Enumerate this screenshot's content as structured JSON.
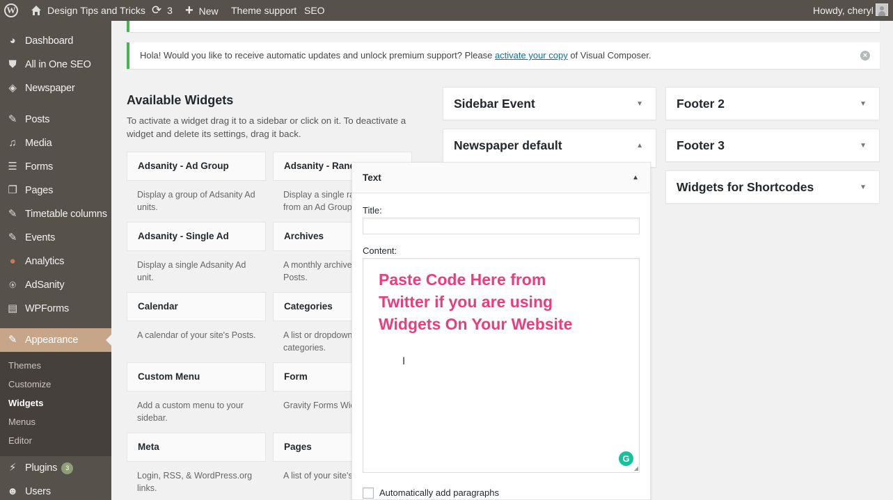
{
  "admin_bar": {
    "site_name": "Design Tips and Tricks",
    "updates_count": "3",
    "new_label": "New",
    "theme_support_label": "Theme support",
    "seo_label": "SEO",
    "howdy": "Howdy, cheryl"
  },
  "sidebar": {
    "items": [
      {
        "label": "Dashboard",
        "icon": "dashboard-icon"
      },
      {
        "label": "All in One SEO",
        "icon": "shield-icon"
      },
      {
        "label": "Newspaper",
        "icon": "newspaper-icon"
      },
      {
        "label": "Posts",
        "icon": "pin-icon"
      },
      {
        "label": "Media",
        "icon": "media-icon"
      },
      {
        "label": "Forms",
        "icon": "forms-icon"
      },
      {
        "label": "Pages",
        "icon": "pages-icon"
      },
      {
        "label": "Timetable columns",
        "icon": "pin-icon"
      },
      {
        "label": "Events",
        "icon": "pin-icon"
      },
      {
        "label": "Analytics",
        "icon": "analytics-icon"
      },
      {
        "label": "AdSanity",
        "icon": "adsanity-icon"
      },
      {
        "label": "WPForms",
        "icon": "wpforms-icon"
      },
      {
        "label": "Appearance",
        "icon": "brush-icon"
      },
      {
        "label": "Plugins",
        "icon": "plugin-icon",
        "badge": "3"
      },
      {
        "label": "Users",
        "icon": "users-icon"
      }
    ],
    "submenu": [
      "Themes",
      "Customize",
      "Widgets",
      "Menus",
      "Editor"
    ],
    "current_submenu": "Widgets"
  },
  "notice": {
    "text_before": "Hola! Would you like to receive automatic updates and unlock premium support? Please ",
    "link": "activate your copy",
    "text_after": " of Visual Composer."
  },
  "available_widgets": {
    "title": "Available Widgets",
    "description": "To activate a widget drag it to a sidebar or click on it. To deactivate a widget and delete its settings, drag it back.",
    "widgets": [
      {
        "title": "Adsanity - Ad Group",
        "desc1": "Display a group of Adsanity Ad",
        "desc2": "units."
      },
      {
        "title": "Adsanity - Random",
        "desc1": "Display a single random",
        "desc2": "from an Ad Group"
      },
      {
        "title": "Adsanity - Single Ad",
        "desc1": "Display a single Adsanity Ad",
        "desc2": "unit."
      },
      {
        "title": "Archives",
        "desc1": "A monthly archive of your site's",
        "desc2": "Posts."
      },
      {
        "title": "Calendar",
        "desc1": "A calendar of your site's Posts.",
        "desc2": ""
      },
      {
        "title": "Categories",
        "desc1": "A list or dropdown of",
        "desc2": "categories."
      },
      {
        "title": "Custom Menu",
        "desc1": "Add a custom menu to your",
        "desc2": "sidebar."
      },
      {
        "title": "Form",
        "desc1": "Gravity Forms Widget",
        "desc2": ""
      },
      {
        "title": "Meta",
        "desc1": "Login, RSS, & WordPress.org",
        "desc2": "links."
      },
      {
        "title": "Pages",
        "desc1": "A list of your site's Pages.",
        "desc2": ""
      }
    ]
  },
  "sidebars": [
    {
      "title": "Sidebar Event",
      "state": "collapsed"
    },
    {
      "title": "Newspaper default",
      "state": "expanded"
    },
    {
      "title": "Footer 2",
      "state": "collapsed"
    },
    {
      "title": "Footer 3",
      "state": "collapsed"
    },
    {
      "title": "Widgets for Shortcodes",
      "state": "collapsed"
    }
  ],
  "text_widget": {
    "header": "Text",
    "title_label": "Title:",
    "title_value": "",
    "content_label": "Content:",
    "annotation": "Paste Code Here from Twitter if you are using Widgets On Your Website",
    "auto_paragraphs_label": "Automatically add paragraphs"
  },
  "colors": {
    "admin_bar_bg": "#57514c",
    "menu_current_bg": "#c7a589",
    "notice_border": "#46b450",
    "annotation_text": "#ed3b7c",
    "link": "#0073aa"
  }
}
